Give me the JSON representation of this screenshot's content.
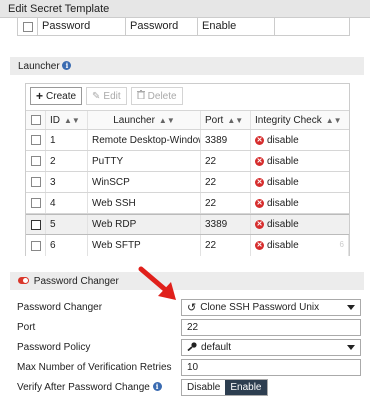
{
  "window": {
    "title": "Edit Secret Template"
  },
  "password_row": {
    "name": "Password",
    "type": "Password",
    "status": "Enable"
  },
  "launcher": {
    "title": "Launcher",
    "toolbar": {
      "create": "Create",
      "edit": "Edit",
      "delete": "Delete"
    },
    "columns": {
      "id": "ID",
      "launcher": "Launcher",
      "port": "Port",
      "integrity": "Integrity Check"
    },
    "rows": [
      {
        "id": "1",
        "launcher": "Remote Desktop-Windows",
        "port": "3389",
        "integrity": "disable"
      },
      {
        "id": "2",
        "launcher": "PuTTY",
        "port": "22",
        "integrity": "disable"
      },
      {
        "id": "3",
        "launcher": "WinSCP",
        "port": "22",
        "integrity": "disable"
      },
      {
        "id": "4",
        "launcher": "Web SSH",
        "port": "22",
        "integrity": "disable"
      },
      {
        "id": "5",
        "launcher": "Web RDP",
        "port": "3389",
        "integrity": "disable"
      },
      {
        "id": "6",
        "launcher": "Web SFTP",
        "port": "22",
        "integrity": "disable"
      }
    ],
    "row_count_hint": "6"
  },
  "password_changer": {
    "title": "Password Changer",
    "fields": {
      "changer_label": "Password Changer",
      "changer_value": "Clone SSH Password Unix",
      "port_label": "Port",
      "port_value": "22",
      "policy_label": "Password Policy",
      "policy_value": "default",
      "retries_label": "Max Number of Verification Retries",
      "retries_value": "10",
      "verify_label": "Verify After Password Change",
      "verify_disable": "Disable",
      "verify_enable": "Enable"
    }
  },
  "colors": {
    "accent_dark": "#2d3e50",
    "danger": "#d62d2d",
    "info": "#3a6bb1",
    "arrow": "#e0201b"
  },
  "icons": [
    "info-icon",
    "plus-icon",
    "pencil-icon",
    "trash-icon",
    "sort-icon",
    "disable-icon",
    "toggle-icon",
    "undo-icon",
    "key-icon",
    "chevron-down-icon",
    "arrow-pointer"
  ]
}
